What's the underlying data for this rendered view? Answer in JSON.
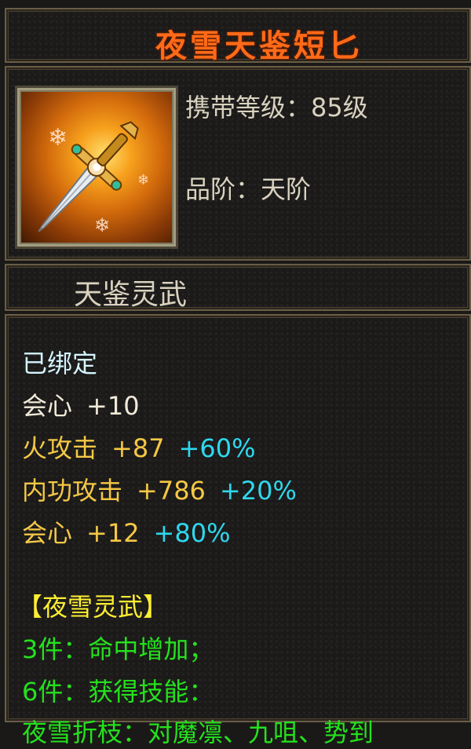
{
  "item": {
    "name": "夜雪天鉴短匕",
    "carry_level": "携带等级：85级",
    "quality": "品阶：天阶",
    "series": "天鉴灵武",
    "icon": "dagger-icon"
  },
  "attributes": {
    "bound": "已绑定",
    "stats": [
      {
        "label": "会心",
        "value": "+10",
        "bonus": ""
      },
      {
        "label": "火攻击",
        "value": "+87",
        "bonus": "+60%"
      },
      {
        "label": "内功攻击",
        "value": "+786",
        "bonus": "+20%"
      },
      {
        "label": "会心",
        "value": "+12",
        "bonus": "+80%"
      }
    ]
  },
  "set": {
    "title": "【夜雪灵武】",
    "effects": [
      "3件：命中增加；",
      "6件：获得技能：",
      "夜雪折枝：对魔凛、九咀、势到"
    ]
  },
  "colors": {
    "title": "#ff6a18",
    "label": "#d9d2bf",
    "bound": "#d4f4ff",
    "stat_white": "#f1ead8",
    "stat_yellow": "#f5c845",
    "bonus": "#2ed8ee",
    "set_title": "#ffef32",
    "set_effect": "#24e21d",
    "frame": "#6a5d45"
  }
}
